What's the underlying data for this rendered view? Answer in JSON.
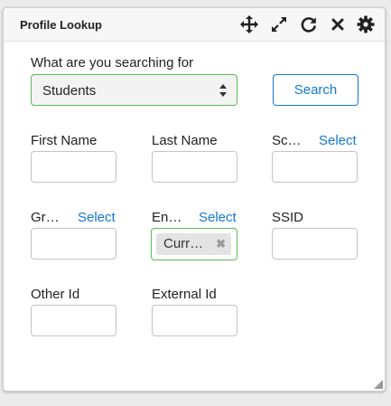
{
  "window": {
    "title": "Profile Lookup",
    "toolbar_icons": [
      "move-icon",
      "expand-icon",
      "refresh-icon",
      "close-icon",
      "gear-icon"
    ]
  },
  "search": {
    "prompt_label": "What are you searching for",
    "type_value": "Students",
    "button_label": "Search"
  },
  "fields": {
    "first_name": {
      "label": "First Name"
    },
    "last_name": {
      "label": "Last Name"
    },
    "school": {
      "label": "Sc…",
      "select_label": "Select"
    },
    "grade": {
      "label": "Gr…",
      "select_label": "Select"
    },
    "enrollment": {
      "label": "En…",
      "select_label": "Select",
      "tag_value": "Curr…"
    },
    "ssid": {
      "label": "SSID"
    },
    "other_id": {
      "label": "Other Id"
    },
    "external_id": {
      "label": "External Id"
    }
  },
  "colors": {
    "link": "#1477d4",
    "valid_border": "#5cb85c",
    "header_bg": "#f7f7f7"
  }
}
